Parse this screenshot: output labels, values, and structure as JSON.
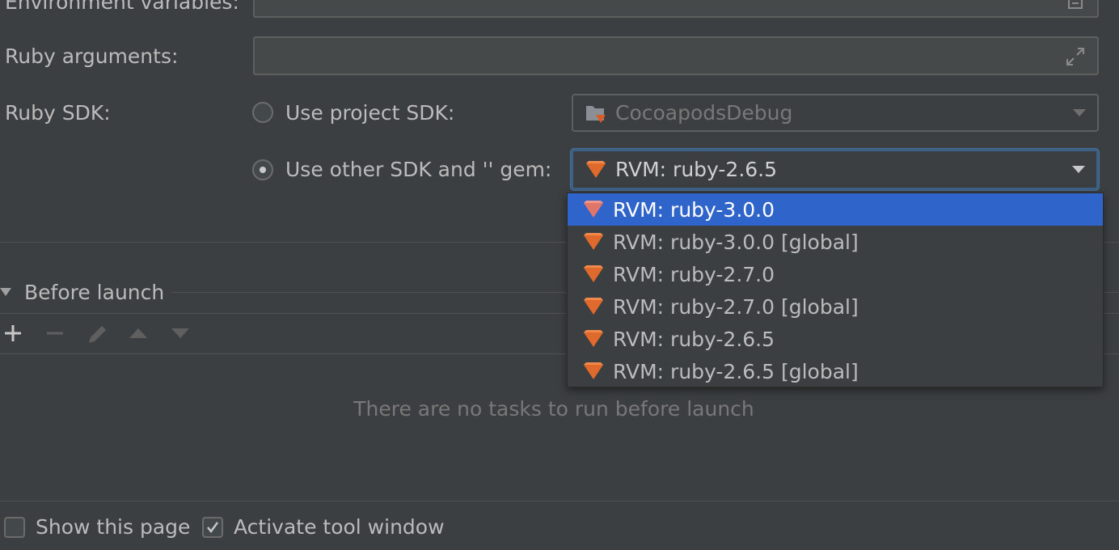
{
  "form": {
    "env_vars_label": "Environment variables:",
    "ruby_args_label": "Ruby arguments:",
    "ruby_sdk_label": "Ruby SDK:",
    "use_project_sdk_label": "Use project SDK:",
    "project_sdk_value": "CocoapodsDebug",
    "use_other_sdk_label": "Use other SDK and '' gem:",
    "other_sdk_value": "RVM: ruby-2.6.5"
  },
  "dropdown": {
    "items": [
      {
        "label": "RVM: ruby-3.0.0",
        "selected": true
      },
      {
        "label": "RVM: ruby-3.0.0 [global]",
        "selected": false
      },
      {
        "label": "RVM: ruby-2.7.0",
        "selected": false
      },
      {
        "label": "RVM: ruby-2.7.0 [global]",
        "selected": false
      },
      {
        "label": "RVM: ruby-2.6.5",
        "selected": false
      },
      {
        "label": "RVM: ruby-2.6.5 [global]",
        "selected": false
      }
    ]
  },
  "before_launch": {
    "title": "Before launch",
    "empty_text": "There are no tasks to run before launch"
  },
  "footer": {
    "show_page_label": "Show this page",
    "show_page_checked": false,
    "activate_tool_label": "Activate tool window",
    "activate_tool_checked": true
  },
  "colors": {
    "background": "#3c3f41",
    "selection": "#2f65ca",
    "ruby_icon": "#e06a2c",
    "focus_border": "#3d6185"
  },
  "icons": {
    "env_browse": "document-icon",
    "expand": "expand-icon",
    "ruby": "ruby-gem-icon",
    "folder": "project-folder-icon"
  }
}
